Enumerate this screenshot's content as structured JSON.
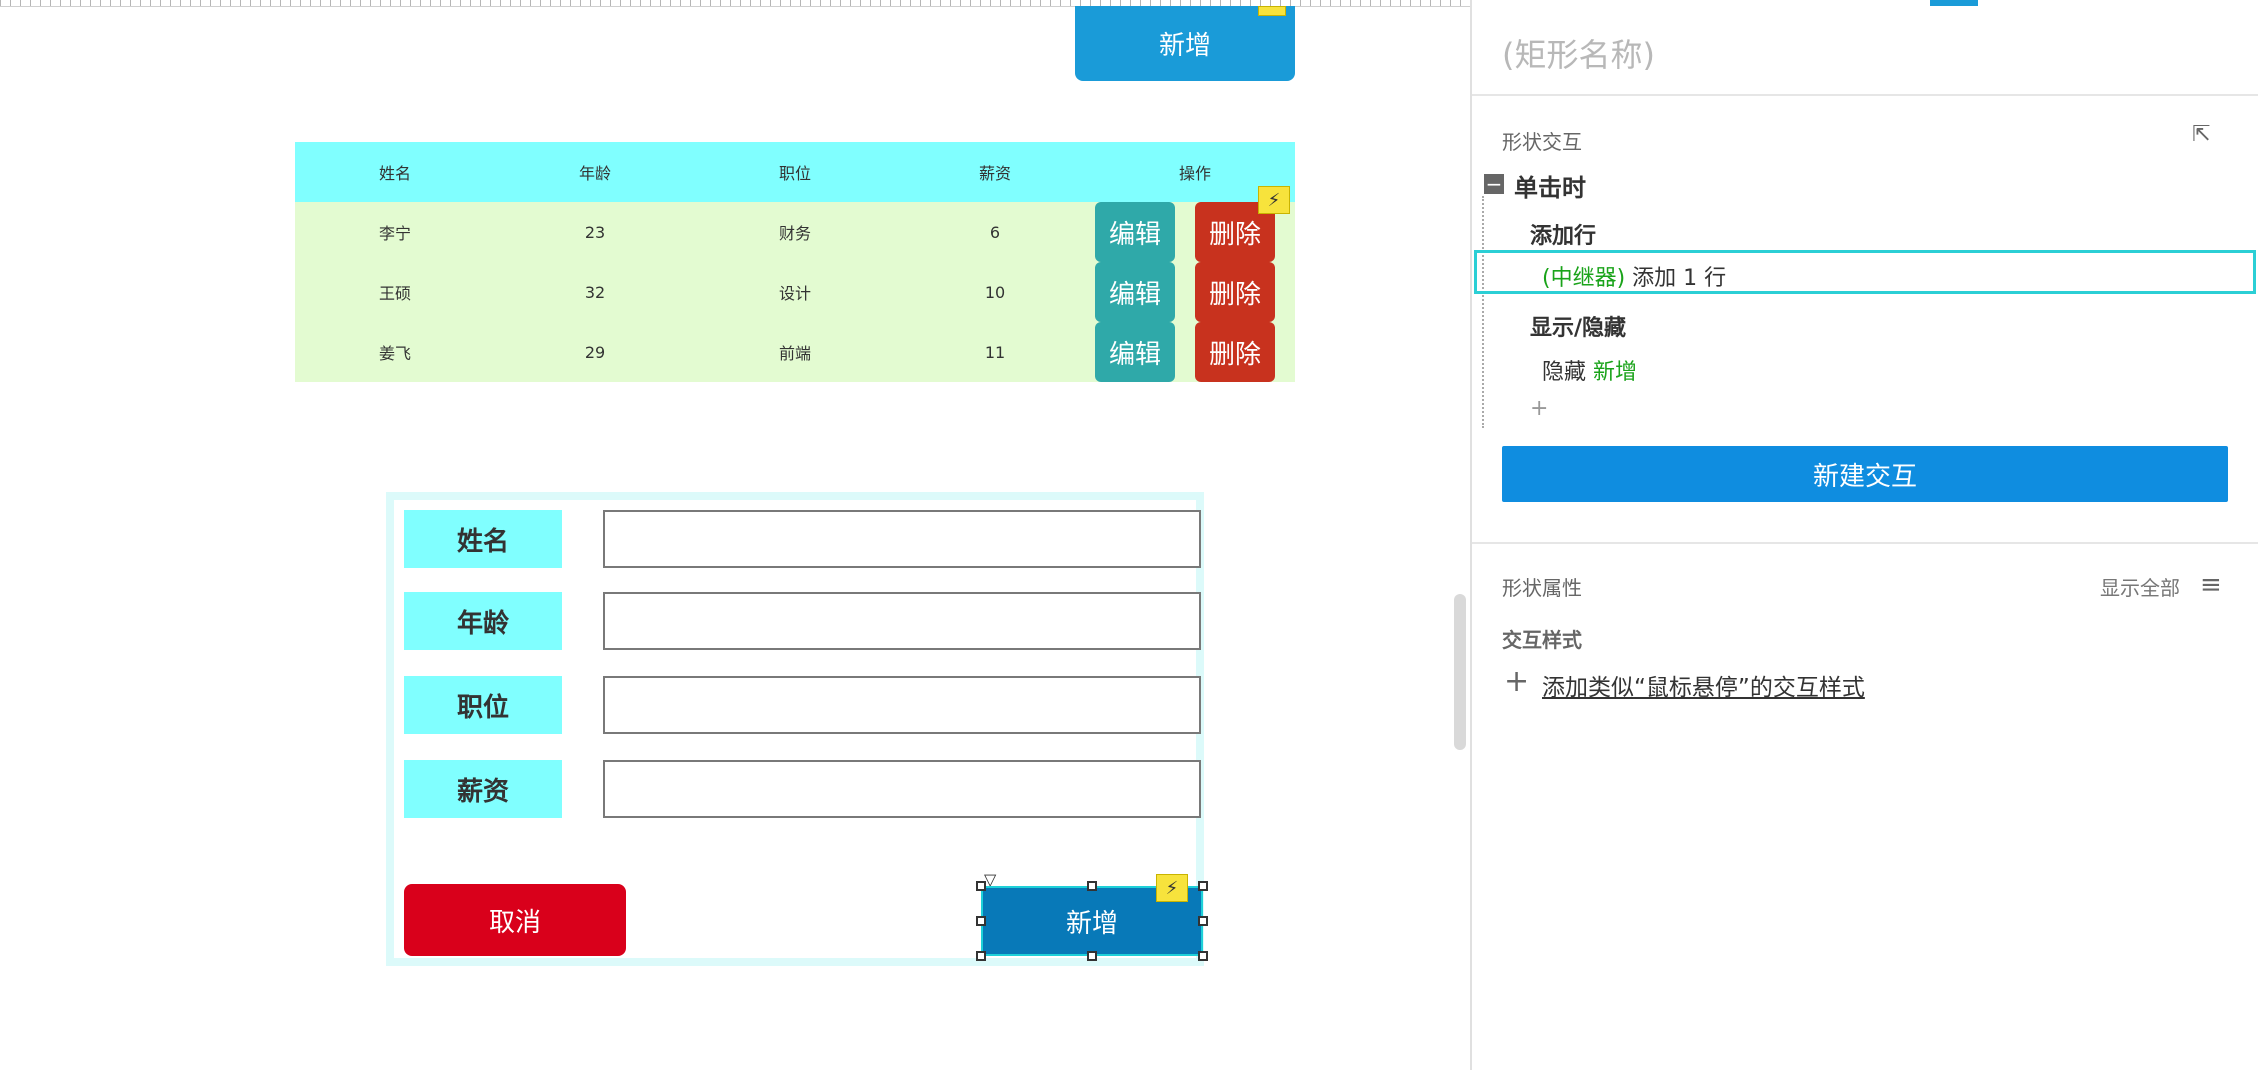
{
  "canvas": {
    "top_add_button": "新增",
    "table": {
      "headers": [
        "姓名",
        "年龄",
        "职位",
        "薪资",
        "操作"
      ],
      "rows": [
        {
          "name": "李宁",
          "age": "23",
          "position": "财务",
          "salary": "6"
        },
        {
          "name": "王硕",
          "age": "32",
          "position": "设计",
          "salary": "10"
        },
        {
          "name": "姜飞",
          "age": "29",
          "position": "前端",
          "salary": "11"
        }
      ],
      "edit_label": "编辑",
      "delete_label": "删除"
    },
    "form": {
      "labels": [
        "姓名",
        "年龄",
        "职位",
        "薪资"
      ],
      "values": [
        "",
        "",
        "",
        ""
      ],
      "cancel_label": "取消",
      "add_label": "新增"
    }
  },
  "panel": {
    "title_placeholder": "(矩形名称)",
    "shape_interaction": "形状交互",
    "event": "单击时",
    "actions": [
      {
        "title": "添加行",
        "items": [
          {
            "target": "(中继器)",
            "text": " 添加 1 行"
          }
        ]
      },
      {
        "title": "显示/隐藏",
        "items": [
          {
            "prefix": "隐藏 ",
            "target": "新增"
          }
        ]
      }
    ],
    "add_action_symbol": "+",
    "new_interaction_label": "新建交互",
    "shape_properties": "形状属性",
    "show_all": "显示全部",
    "interaction_style_title": "交互样式",
    "add_style_link": "添加类似“鼠标悬停”的交互样式"
  },
  "icons": {
    "flash": "lightning-icon",
    "corner": "select-corner-icon",
    "menu": "menu-icon",
    "collapse": "minus-icon"
  },
  "colors": {
    "table_header": "#80ffff",
    "table_row": "#e3fbd1",
    "edit": "#2fa9a9",
    "delete": "#c8321e",
    "cancel": "#d9001b",
    "add": "#0879b8",
    "primary": "#0f8de0"
  }
}
